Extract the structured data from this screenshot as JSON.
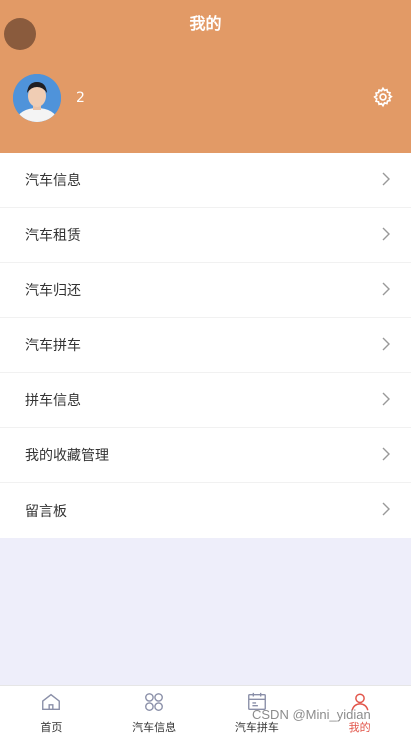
{
  "header": {
    "title": "我的",
    "user_name": "2"
  },
  "menu": {
    "items": [
      {
        "label": "汽车信息"
      },
      {
        "label": "汽车租赁"
      },
      {
        "label": "汽车归还"
      },
      {
        "label": "汽车拼车"
      },
      {
        "label": "拼车信息"
      },
      {
        "label": "我的收藏管理"
      },
      {
        "label": "留言板"
      }
    ]
  },
  "tabbar": {
    "items": [
      {
        "label": "首页",
        "icon": "home-icon"
      },
      {
        "label": "汽车信息",
        "icon": "grid-flower-icon"
      },
      {
        "label": "汽车拼车",
        "icon": "calendar-icon"
      },
      {
        "label": "我的",
        "icon": "person-icon",
        "active": true
      }
    ]
  },
  "watermark": "CSDN @Mini_yidian",
  "colors": {
    "header_bg": "#e29a66",
    "active_tab": "#e2554a",
    "page_bg": "#eeeefa"
  }
}
